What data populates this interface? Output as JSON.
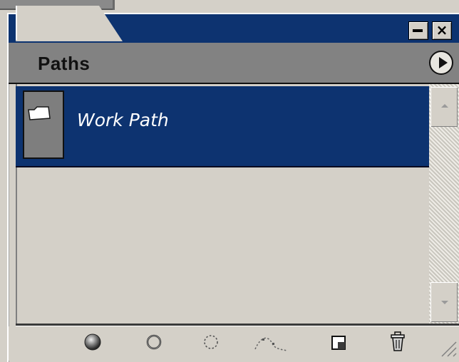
{
  "panel": {
    "tab_label": "Paths",
    "close_glyph": "×",
    "minimize_icon": "minimize-icon",
    "menu_icon": "panel-menu-icon"
  },
  "paths": [
    {
      "label": "Work Path",
      "selected": true,
      "thumbnail_icon": "path-thumbnail-icon"
    }
  ],
  "toolbar": {
    "icons": [
      "fill-path-icon",
      "stroke-path-icon",
      "load-path-as-selection-icon",
      "make-work-path-icon",
      "create-new-path-icon",
      "delete-path-icon"
    ]
  },
  "colors": {
    "titlebar": "#0d3370",
    "selection": "#0d3370",
    "panel_bg": "#d4d0c8",
    "tab_strip": "#828282"
  }
}
